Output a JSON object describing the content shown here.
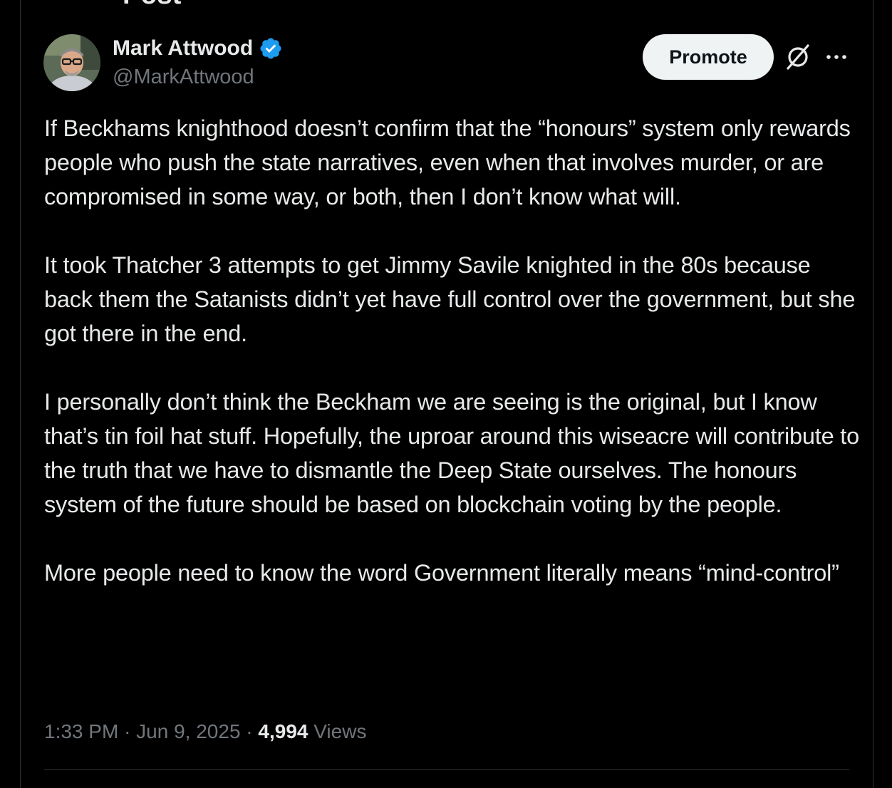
{
  "header": {
    "title": "Post"
  },
  "author": {
    "name": "Mark Attwood",
    "handle": "@MarkAttwood",
    "verified": true
  },
  "actions": {
    "promote_label": "Promote",
    "grok_icon": "grok-icon",
    "more_icon": "more-options-icon"
  },
  "post": {
    "paragraphs": [
      "If Beckhams knighthood doesn’t confirm that the “honours” system only rewards people who push the state narratives, even when that involves murder, or are compromised in some way, or both, then I don’t know what will.",
      "It took Thatcher 3 attempts to get Jimmy Savile knighted in the 80s because back them the Satanists didn’t yet have full control over the government, but she got there in the end.",
      "I personally don’t think the Beckham we are seeing is the original, but I know that’s tin foil hat stuff. Hopefully, the uproar around this wiseacre will contribute to the truth that we have to dismantle the Deep State ourselves. The honours system of the future should be based on blockchain voting by the people.",
      "More people need to know the word Government literally means “mind-control”"
    ]
  },
  "meta": {
    "time": "1:33 PM",
    "separator": "·",
    "date": "Jun 9, 2025",
    "views_count": "4,994",
    "views_label": "Views"
  },
  "colors": {
    "background": "#000000",
    "text_primary": "#e7e9ea",
    "text_secondary": "#71767b",
    "verified_blue": "#1d9bf0",
    "divider": "#2f3336",
    "promote_bg": "#eff3f4"
  }
}
